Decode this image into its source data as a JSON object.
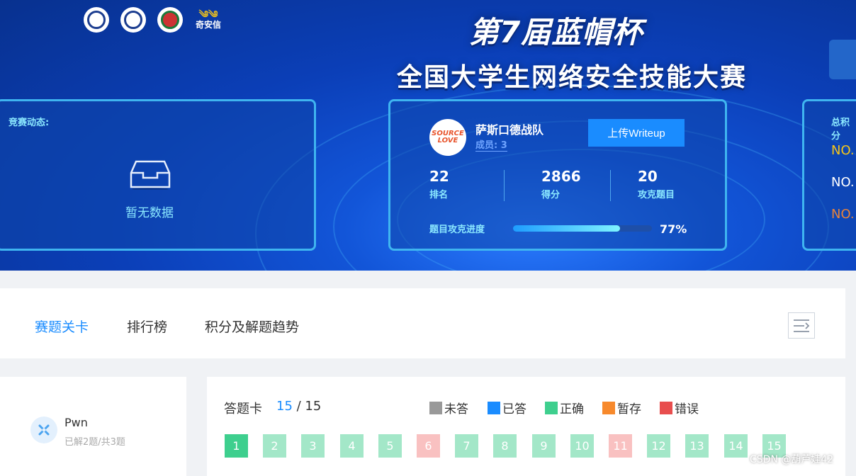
{
  "banner": {
    "title_line1": "第7届蓝帽杯",
    "title_line2": "全国大学生网络安全技能大赛",
    "sponsor_text": "奇安信",
    "sponsor_mark": "༄༄"
  },
  "news": {
    "label": "竞赛动态:",
    "empty_text": "暂无数据"
  },
  "team": {
    "avatar_text": "SOURCE LOVE",
    "name": "萨斯口德战队",
    "members": "成员: 3",
    "upload_label": "上传Writeup",
    "stats": [
      {
        "value": "22",
        "label": "排名"
      },
      {
        "value": "2866",
        "label": "得分"
      },
      {
        "value": "20",
        "label": "攻克题目"
      }
    ],
    "progress_label": "题目攻克进度",
    "progress_value": "77%",
    "progress_fraction": 0.77
  },
  "scoreboard": {
    "label": "总积分",
    "entries": [
      "NO.",
      "NO.",
      "NO."
    ],
    "colors": [
      "#f5c518",
      "#ffffff",
      "#e8833a"
    ]
  },
  "tabs": [
    {
      "label": "赛题关卡",
      "active": true
    },
    {
      "label": "排行榜",
      "active": false
    },
    {
      "label": "积分及解题趋势",
      "active": false
    }
  ],
  "category": {
    "name": "Pwn",
    "sub": "已解2题/共3题"
  },
  "answer_card": {
    "title": "答题卡",
    "current": "15",
    "total": "/ 15",
    "legend": [
      {
        "label": "未答",
        "color": "#999999"
      },
      {
        "label": "已答",
        "color": "#1a8cff"
      },
      {
        "label": "正确",
        "color": "#3ecf8e"
      },
      {
        "label": "暂存",
        "color": "#f7892c"
      },
      {
        "label": "错误",
        "color": "#e84e4e"
      }
    ],
    "questions": [
      {
        "n": "1",
        "color": "#3ecf8e"
      },
      {
        "n": "2",
        "color": "#a3e7c8"
      },
      {
        "n": "3",
        "color": "#a3e7c8"
      },
      {
        "n": "4",
        "color": "#a3e7c8"
      },
      {
        "n": "5",
        "color": "#a3e7c8"
      },
      {
        "n": "6",
        "color": "#f9c1c1"
      },
      {
        "n": "7",
        "color": "#a3e7c8"
      },
      {
        "n": "8",
        "color": "#a3e7c8"
      },
      {
        "n": "9",
        "color": "#a3e7c8"
      },
      {
        "n": "10",
        "color": "#a3e7c8"
      },
      {
        "n": "11",
        "color": "#f9c1c1"
      },
      {
        "n": "12",
        "color": "#a3e7c8"
      },
      {
        "n": "13",
        "color": "#a3e7c8"
      },
      {
        "n": "14",
        "color": "#a3e7c8"
      },
      {
        "n": "15",
        "color": "#a3e7c8"
      }
    ]
  },
  "watermark": "CSDN @葫芦娃42"
}
